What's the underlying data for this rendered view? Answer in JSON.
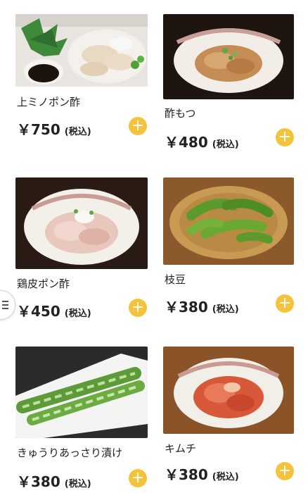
{
  "currency_symbol": "￥",
  "tax_label": "(税込)",
  "add_button_glyph": "+",
  "menu_icon": "hamburger-icon",
  "colors": {
    "add_button": "#f5c33b",
    "background": "#ffffff",
    "text": "#222222"
  },
  "items": [
    {
      "name": "上ミノポン酢",
      "price": "750"
    },
    {
      "name": "酢もつ",
      "price": "480"
    },
    {
      "name": "鶏皮ポン酢",
      "price": "450"
    },
    {
      "name": "枝豆",
      "price": "380"
    },
    {
      "name": "きゅうりあっさり漬け",
      "price": "380"
    },
    {
      "name": "キムチ",
      "price": "380"
    }
  ]
}
